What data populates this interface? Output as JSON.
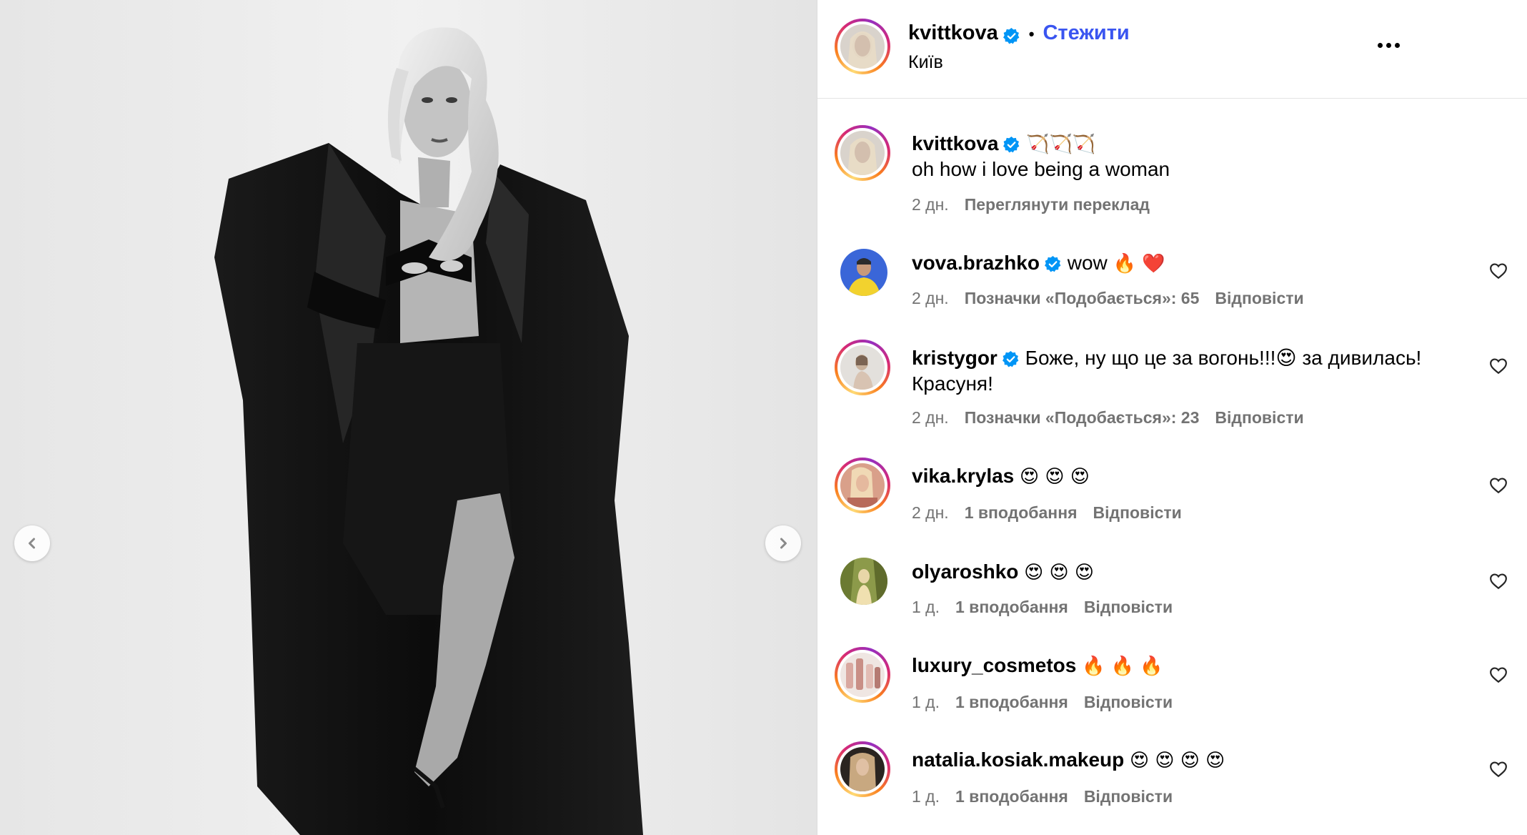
{
  "post": {
    "author": "kvittkova",
    "follow_label": "Стежити",
    "separator": "•",
    "location": "Київ"
  },
  "caption": {
    "author": "kvittkova",
    "emojis": "🏹🏹🏹",
    "text": "oh how i love being a woman",
    "time": "2 дн.",
    "translate_label": "Переглянути переклад"
  },
  "comments": [
    {
      "author": "vova.brazhko",
      "verified": true,
      "text": "wow",
      "emojis": "🔥 ❤️",
      "time": "2 дн.",
      "likes": "Позначки «Подобається»: 65",
      "reply": "Відповісти"
    },
    {
      "author": "kristygor",
      "verified": true,
      "text": "Боже, ну що це за вогонь!!!😍 за дивилась! Красуня!",
      "time": "2 дн.",
      "likes": "Позначки «Подобається»: 23",
      "reply": "Відповісти"
    },
    {
      "author": "vika.krylas",
      "verified": false,
      "text": "",
      "emojis": "😍 😍 😍",
      "time": "2 дн.",
      "likes": "1 вподобання",
      "reply": "Відповісти"
    },
    {
      "author": "olyaroshko",
      "verified": false,
      "text": "",
      "emojis": "😍 😍 😍",
      "time": "1 д.",
      "likes": "1 вподобання",
      "reply": "Відповісти"
    },
    {
      "author": "luxury_cosmetos",
      "verified": false,
      "text": "",
      "emojis": "🔥 🔥 🔥",
      "time": "1 д.",
      "likes": "1 вподобання",
      "reply": "Відповісти"
    },
    {
      "author": "natalia.kosiak.makeup",
      "verified": false,
      "text": "",
      "emojis": "😍 😍 😍 😍",
      "time": "1 д.",
      "likes": "1 вподобання",
      "reply": "Відповісти"
    }
  ],
  "icons": {
    "verified": "verified-badge-icon",
    "heart": "heart-outline-icon",
    "prev": "chevron-left-icon",
    "next": "chevron-right-icon",
    "more": "more-horizontal-icon"
  },
  "colors": {
    "accent": "#3a55f0",
    "verified": "#0095f6",
    "meta": "#737373",
    "divider": "#dbdbdb"
  }
}
